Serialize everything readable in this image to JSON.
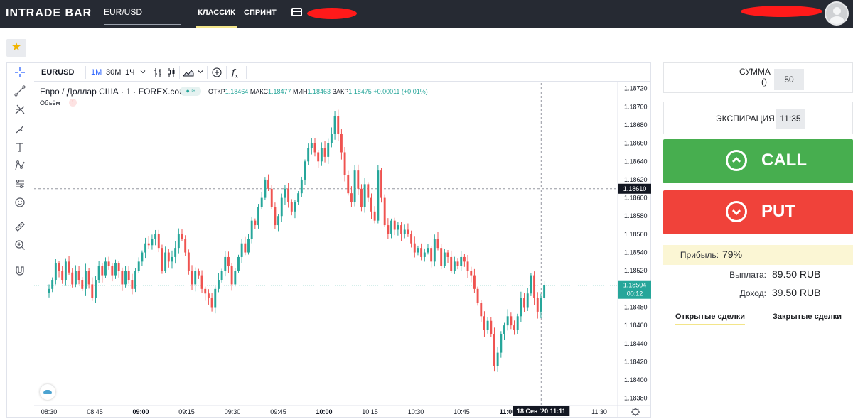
{
  "app": {
    "logo_text": "INTRADE BAR",
    "asset": "EUR/USD",
    "nav": [
      {
        "label": "КЛАССИК",
        "active": true
      },
      {
        "label": "СПРИНТ",
        "active": false
      }
    ]
  },
  "chart_toolbar": {
    "symbol": "EURUSD",
    "intervals": [
      "1M",
      "30M",
      "1Ч"
    ],
    "active_interval": "1M",
    "icons": [
      "bars-icon",
      "candles-icon",
      "area-icon",
      "indicators-icon",
      "fx-icon"
    ]
  },
  "left_tools": [
    "crosshair-icon",
    "trendline-icon",
    "pitchfork-icon",
    "brush-icon",
    "text-icon",
    "pattern-icon",
    "prediction-icon",
    "emoji-icon",
    "ruler-icon",
    "zoom-icon",
    "magnet-icon"
  ],
  "legend": {
    "title": "Евро / Доллар США · 1 · FOREX.com",
    "badge": "≈",
    "open_label": "ОТКР",
    "open": "1.18464",
    "high_label": "МАКС",
    "high": "1.18477",
    "low_label": "МИН",
    "low": "1.18463",
    "close_label": "ЗАКР",
    "close": "1.18475",
    "change": "+0.00011 (+0.01%)",
    "volume_label": "Объём",
    "volume_warning": "!"
  },
  "chart_data": {
    "type": "candlestick",
    "x_ticks": [
      "08:30",
      "08:45",
      "09:00",
      "09:15",
      "09:30",
      "09:45",
      "10:00",
      "10:15",
      "10:30",
      "10:45",
      "11:00",
      "11:30"
    ],
    "y_ticks": [
      "1.18720",
      "1.18700",
      "1.18680",
      "1.18660",
      "1.18640",
      "1.18620",
      "1.18600",
      "1.18580",
      "1.18560",
      "1.18540",
      "1.18520",
      "1.18500",
      "1.18480",
      "1.18460",
      "1.18440",
      "1.18420",
      "1.18400",
      "1.18380"
    ],
    "ylim": [
      1.18372,
      1.18726
    ],
    "crosshair_price": "1.18610",
    "current_price": "1.18504",
    "countdown": "00:12",
    "crosshair_date": "18 Сен '20",
    "crosshair_time": "11:11",
    "up_color": "#26a69a",
    "down_color": "#ef5350",
    "first_time": "08:30",
    "last_time": "11:12",
    "closes": [
      1.185,
      1.1851,
      1.18528,
      1.1852,
      1.1851,
      1.1853,
      1.18518,
      1.18505,
      1.1852,
      1.1851,
      1.185,
      1.1852,
      1.18505,
      1.1849,
      1.1851,
      1.18525,
      1.18515,
      1.1853,
      1.18525,
      1.18515,
      1.18528,
      1.1852,
      1.18505,
      1.1852,
      1.1851,
      1.185,
      1.1852,
      1.1853,
      1.1854,
      1.1855,
      1.18548,
      1.18555,
      1.1856,
      1.18545,
      1.1852,
      1.1854,
      1.1853,
      1.18535,
      1.18545,
      1.1856,
      1.18555,
      1.1854,
      1.1852,
      1.18505,
      1.1852,
      1.18515,
      1.185,
      1.18495,
      1.1849,
      1.1848,
      1.185,
      1.1851,
      1.1852,
      1.18535,
      1.18525,
      1.18505,
      1.1852,
      1.18535,
      1.1855,
      1.1854,
      1.18555,
      1.18575,
      1.1857,
      1.1859,
      1.186,
      1.1862,
      1.1861,
      1.1859,
      1.1857,
      1.1858,
      1.186,
      1.1861,
      1.18595,
      1.18585,
      1.18595,
      1.18605,
      1.1862,
      1.1864,
      1.18655,
      1.1866,
      1.1865,
      1.1864,
      1.18655,
      1.18645,
      1.1866,
      1.1867,
      1.1869,
      1.1867,
      1.1865,
      1.18625,
      1.18605,
      1.18595,
      1.1863,
      1.1861,
      1.1859,
      1.18615,
      1.186,
      1.18585,
      1.18575,
      1.1863,
      1.186,
      1.1857,
      1.1856,
      1.18575,
      1.18565,
      1.1857,
      1.1856,
      1.18565,
      1.1856,
      1.1855,
      1.1854,
      1.18545,
      1.18535,
      1.1854,
      1.18545,
      1.1853,
      1.18555,
      1.18545,
      1.18525,
      1.1854,
      1.18535,
      1.1852,
      1.1853,
      1.18525,
      1.18535,
      1.1853,
      1.1852,
      1.18515,
      1.185,
      1.18485,
      1.1847,
      1.18455,
      1.18465,
      1.1845,
      1.18415,
      1.1843,
      1.1845,
      1.1846,
      1.1847,
      1.1846,
      1.18455,
      1.1847,
      1.1849,
      1.1848,
      1.18495,
      1.18515,
      1.1849,
      1.18475,
      1.1849,
      1.18504
    ]
  },
  "trade": {
    "amount_label": "СУММА",
    "amount_sub": "()",
    "amount_value": "50",
    "expiration_label": "ЭКСПИРАЦИЯ",
    "expiration_value": "11:35",
    "call_label": "CALL",
    "put_label": "PUT",
    "profit_label": "Прибыль:",
    "profit_value": "79%",
    "payout_label": "Выплата:",
    "payout_value": "89.50 RUB",
    "income_label": "Доход:",
    "income_value": "39.50 RUB",
    "tabs": [
      "Открытые сделки",
      "Закрытые сделки"
    ]
  }
}
